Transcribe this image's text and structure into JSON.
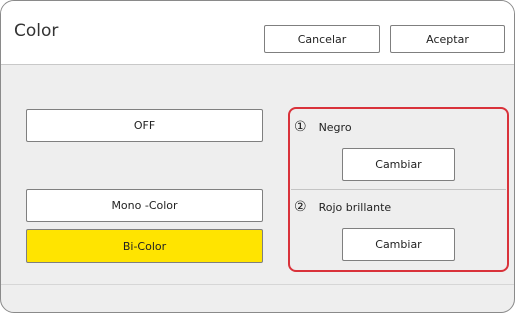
{
  "header": {
    "title": "Color",
    "cancel_label": "Cancelar",
    "accept_label": "Aceptar"
  },
  "modes": {
    "off_label": "OFF",
    "mono_label": "Mono -Color",
    "bi_label": "Bi-Color",
    "selected": "Bi-Color",
    "selected_color": "#ffe400"
  },
  "drums": {
    "highlight_color": "#d9323a",
    "items": [
      {
        "number": "①",
        "color_name": "Negro",
        "change_label": "Cambiar"
      },
      {
        "number": "②",
        "color_name": "Rojo brillante",
        "change_label": "Cambiar"
      }
    ]
  }
}
